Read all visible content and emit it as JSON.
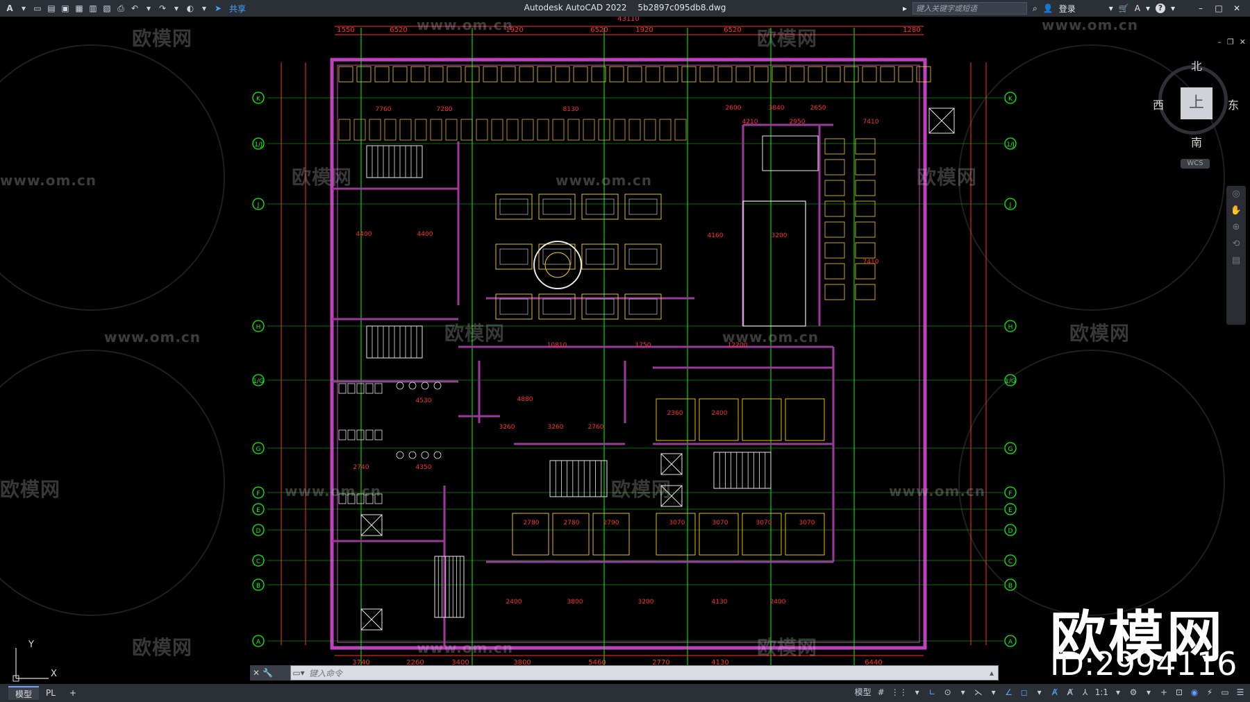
{
  "titlebar": {
    "app_name": "Autodesk AutoCAD 2022",
    "file_name": "5b2897c095db8.dwg",
    "share_label": "共享",
    "search_placeholder": "键入关键字或短语",
    "login_label": "登录",
    "help_label": "?"
  },
  "viewcube": {
    "north": "北",
    "south": "南",
    "west": "西",
    "east": "东",
    "face": "上",
    "wcs": "WCS"
  },
  "ucs": {
    "x": "X",
    "y": "Y"
  },
  "command": {
    "placeholder": "键入命令"
  },
  "status": {
    "tabs": [
      "模型",
      "PL"
    ],
    "model_label": "模型",
    "scale": "1:1"
  },
  "watermark": {
    "brand": "欧模网",
    "url": "www.om.cn",
    "big_brand": "欧模网",
    "id_text": "ID:2994116"
  },
  "plan": {
    "grid_rows": [
      "K",
      "1/J",
      "J",
      "H",
      "1/G",
      "G",
      "F",
      "E",
      "D",
      "C",
      "B",
      "A"
    ],
    "top_dims": [
      "1550",
      "6520",
      "1920",
      "6520",
      "1920",
      "6520",
      "1280"
    ],
    "top_total": "43110",
    "bottom_dims": [
      "3740",
      "2260",
      "3400",
      "3800",
      "5460",
      "2770",
      "4130",
      "6440"
    ],
    "room_dims": [
      "7760",
      "7280",
      "8130",
      "2600",
      "3840",
      "2650",
      "4210",
      "2950",
      "7410",
      "4400",
      "4400",
      "4160",
      "3200",
      "7410",
      "10810",
      "1750",
      "12200",
      "4530",
      "4350",
      "2740",
      "2780",
      "2780",
      "2790",
      "3070",
      "3070",
      "3070",
      "3070",
      "3260",
      "3260",
      "2760",
      "4880",
      "2360",
      "2400",
      "2400",
      "3800",
      "3200",
      "4130",
      "2400"
    ],
    "colors": {
      "wall": "#c040c0",
      "dim": "#ff3030",
      "grid": "#00ff00",
      "furniture": "#e8e8e8",
      "bubble": "#00ff00",
      "accent": "#ffd400"
    }
  }
}
